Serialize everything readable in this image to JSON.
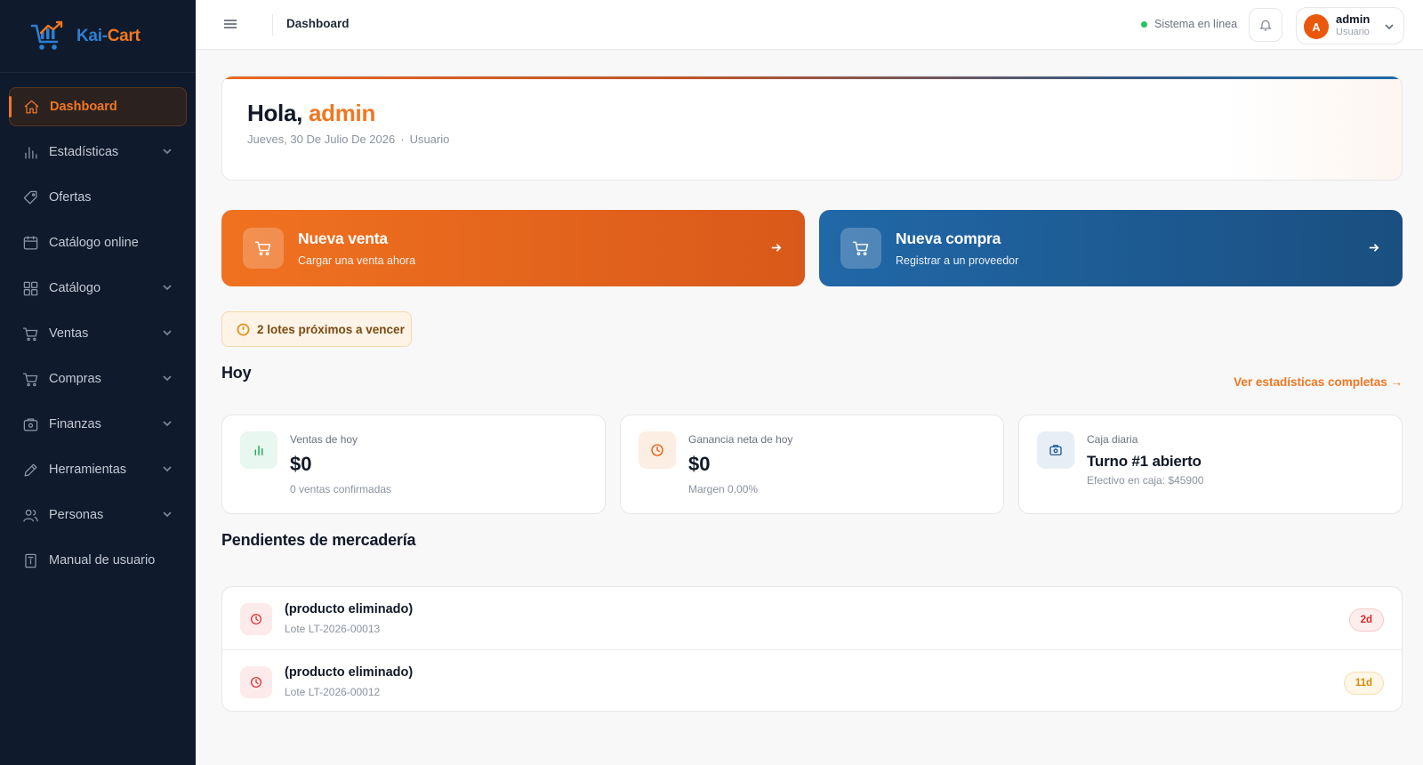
{
  "brand": {
    "name_part1": "Kai-",
    "name_part2": "Cart",
    "color_blue": "#2d7fd1",
    "color_orange": "#f07722"
  },
  "sidebar": {
    "items": [
      {
        "label": "Dashboard",
        "icon": "home-icon",
        "active": true,
        "has_children": false
      },
      {
        "label": "Estadísticas",
        "icon": "bar-chart-icon",
        "has_children": true
      },
      {
        "label": "Ofertas",
        "icon": "tag-icon",
        "has_children": false
      },
      {
        "label": "Catálogo online",
        "icon": "calendar-icon",
        "has_children": false
      },
      {
        "label": "Catálogo",
        "icon": "grid-icon",
        "has_children": true
      },
      {
        "label": "Ventas",
        "icon": "cart-icon",
        "has_children": true
      },
      {
        "label": "Compras",
        "icon": "cart-icon",
        "has_children": true
      },
      {
        "label": "Finanzas",
        "icon": "wallet-icon",
        "has_children": true
      },
      {
        "label": "Herramientas",
        "icon": "pencil-icon",
        "has_children": true
      },
      {
        "label": "Personas",
        "icon": "users-icon",
        "has_children": true
      },
      {
        "label": "Manual de usuario",
        "icon": "book-icon",
        "has_children": false
      }
    ]
  },
  "topbar": {
    "title": "Dashboard",
    "status_text": "Sistema en línea",
    "status_color": "#22c55e",
    "user": {
      "initial": "A",
      "name": "admin",
      "role": "Usuario"
    }
  },
  "hero": {
    "greeting": "Hola, ",
    "username": "admin",
    "date": "Jueves, 30 De Julio De 2026",
    "separator": "·",
    "role": "Usuario"
  },
  "actions": {
    "sale": {
      "title": "Nueva venta",
      "subtitle": "Cargar una venta ahora",
      "color": "#f07220"
    },
    "buy": {
      "title": "Nueva compra",
      "subtitle": "Registrar a un proveedor",
      "color": "#2168a8"
    }
  },
  "alert": {
    "text": "2 lotes próximos a vencer"
  },
  "today": {
    "title": "Hoy",
    "link": "Ver estadísticas completas →",
    "cards": [
      {
        "label": "Ventas de hoy",
        "value": "$0",
        "note": "0 ventas confirmadas",
        "icon": "bar-chart-icon"
      },
      {
        "label": "Ganancia neta de hoy",
        "value": "$0",
        "note": "Margen 0,00%",
        "icon": "clock-icon"
      },
      {
        "label": "Caja diaria",
        "value": "Turno #1 abierto",
        "note": "Efectivo en caja: $45900",
        "icon": "cash-register-icon"
      }
    ]
  },
  "pending": {
    "title": "Pendientes de mercadería",
    "rows": [
      {
        "name": "(producto eliminado)",
        "lote": "Lote LT-2026-00013",
        "badge": "2d",
        "badge_color": "#dc2626"
      },
      {
        "name": "(producto eliminado)",
        "lote": "Lote LT-2026-00012",
        "badge": "11d",
        "badge_color": "#d48806"
      }
    ]
  }
}
